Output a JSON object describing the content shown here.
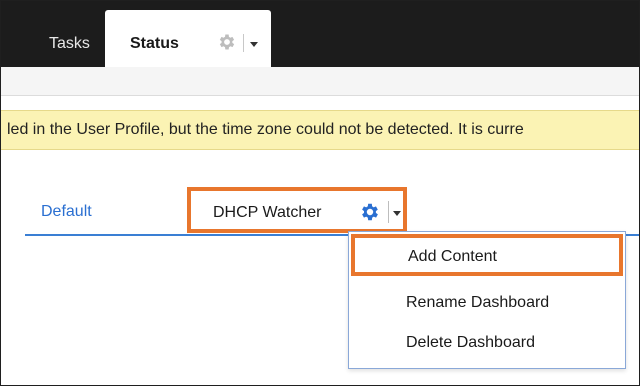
{
  "top_tabs": {
    "tasks_label": "Tasks",
    "status_label": "Status"
  },
  "banner": {
    "text": "led in the User Profile, but the time zone could not be detected. It is curre"
  },
  "dashboard_tabs": {
    "default_label": "Default",
    "active_label": "DHCP Watcher"
  },
  "menu": {
    "items": [
      {
        "label": "Add Content",
        "highlighted": true
      },
      {
        "label": "Rename Dashboard",
        "highlighted": false
      },
      {
        "label": "Delete Dashboard",
        "highlighted": false
      }
    ]
  },
  "colors": {
    "topbar_bg": "#1c1c1c",
    "banner_bg": "#fbf3b4",
    "accent_blue": "#2a6fd1",
    "highlight_orange": "#e8762d"
  },
  "icons": {
    "status_tab_icon": "gear-icon",
    "dashboard_icon": "gear-icon",
    "menu_toggle_icon": "chevron-down-icon"
  }
}
